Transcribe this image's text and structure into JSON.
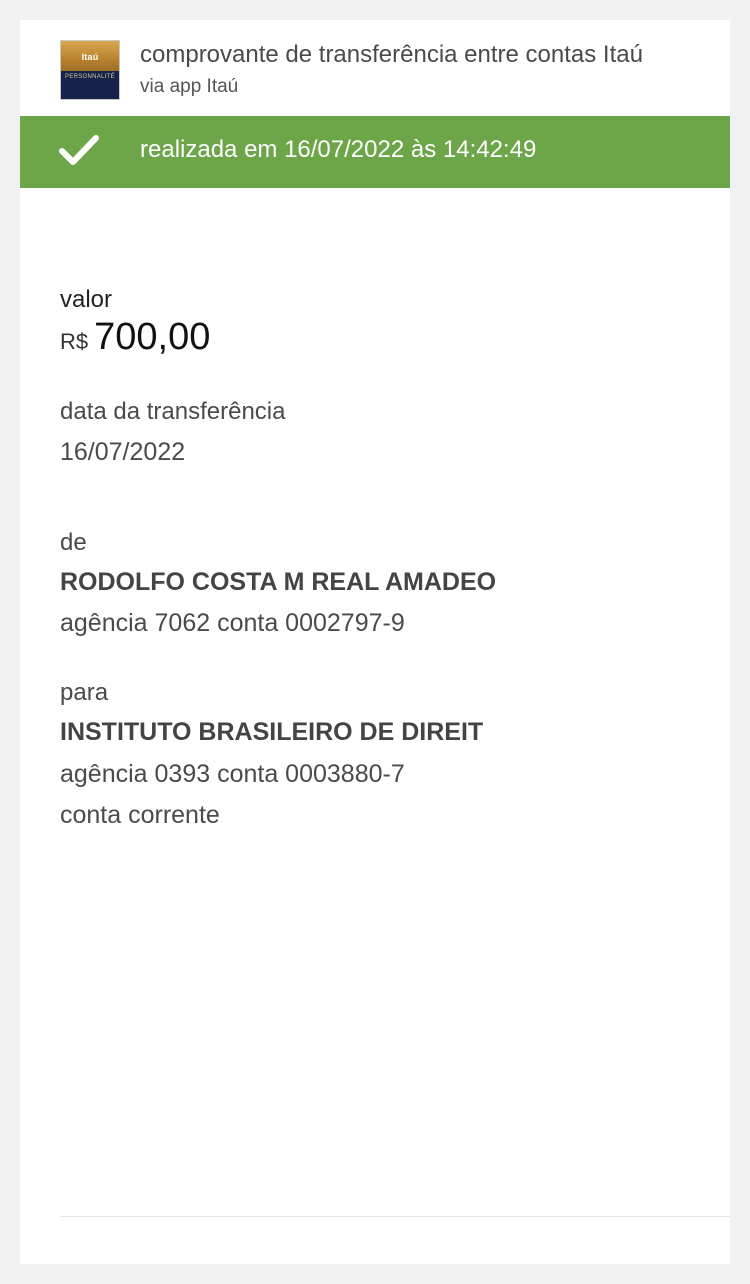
{
  "header": {
    "logo_top_text": "Itaú",
    "logo_bottom_text": "PERSONNALITÉ",
    "title": "comprovante de transferência entre contas Itaú",
    "subtitle": "via app Itaú"
  },
  "status": {
    "text": "realizada em 16/07/2022 às 14:42:49",
    "icon": "check-icon",
    "color": "#6da649"
  },
  "transfer": {
    "value_label": "valor",
    "currency": "R$",
    "amount": "700,00",
    "date_label": "data da transferência",
    "date": "16/07/2022"
  },
  "from": {
    "label": "de",
    "name": "RODOLFO COSTA M REAL AMADEO",
    "account": "agência 7062 conta 0002797-9"
  },
  "to": {
    "label": "para",
    "name": "INSTITUTO BRASILEIRO DE DIREIT",
    "account": "agência 0393 conta 0003880-7",
    "account_type": "conta corrente"
  }
}
